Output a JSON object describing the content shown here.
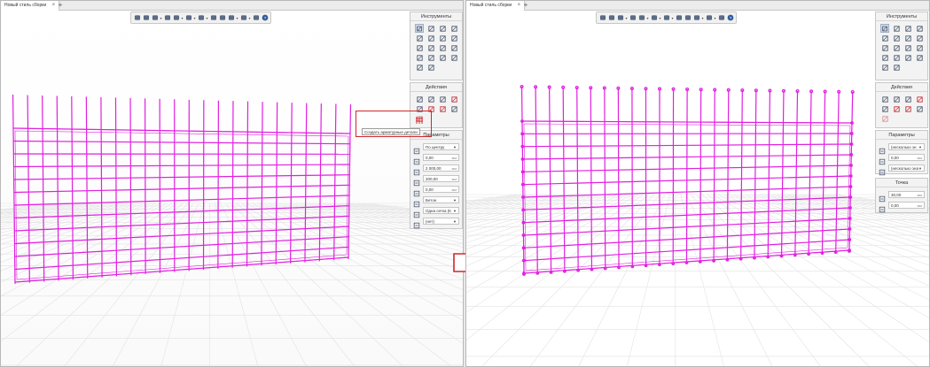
{
  "left_pane": {
    "tab_title": "Новый стиль сборки",
    "tab_close": "×",
    "tab_add": "+",
    "tools_title": "Инструменты",
    "actions_title": "Действия",
    "params_title": "Параметры",
    "tooltip": "Создать арматурные детали",
    "params": [
      {
        "icon": "alignment-icon",
        "value": "По центру",
        "unit": "",
        "dropdown": true
      },
      {
        "icon": "offset-icon",
        "value": "0,00",
        "unit": "мм",
        "dropdown": false
      },
      {
        "icon": "length-icon",
        "value": "2 000,00",
        "unit": "мм",
        "dropdown": false
      },
      {
        "icon": "width-icon",
        "value": "200,00",
        "unit": "мм",
        "dropdown": false
      },
      {
        "icon": "height-icon",
        "value": "0,00",
        "unit": "мм",
        "dropdown": false
      },
      {
        "icon": "material-icon",
        "value": "Бетон",
        "unit": "",
        "dropdown": true
      },
      {
        "icon": "mesh-icon",
        "value": "Одна сетка (К",
        "unit": "",
        "dropdown": true
      },
      {
        "icon": "rebar-icon",
        "value": "(нет)",
        "unit": "",
        "dropdown": true
      }
    ]
  },
  "right_pane": {
    "tab_title": "Новый стиль сборки",
    "tab_close": "×",
    "tab_add": "+",
    "tools_title": "Инструменты",
    "actions_title": "Действия",
    "params_title": "Параметры",
    "point_title": "Точка",
    "params": [
      {
        "icon": "spacing-icon",
        "value": "(несколько зн",
        "unit": "",
        "dropdown": true
      },
      {
        "icon": "offset-icon",
        "value": "0,00",
        "unit": "мм",
        "dropdown": false
      },
      {
        "icon": "rebar-icon",
        "value": "(несколько зна",
        "unit": "",
        "dropdown": true
      }
    ],
    "point": [
      {
        "icon": "point-x-icon",
        "value": "30,00",
        "unit": "мм"
      },
      {
        "icon": "point-y-icon",
        "value": "0,00",
        "unit": "мм"
      }
    ]
  },
  "colors": {
    "mesh": "#e020e0",
    "tooltip_frame": "#d1262a",
    "arrow": "#d1262a",
    "selected_tool": "#cfd8e6"
  }
}
